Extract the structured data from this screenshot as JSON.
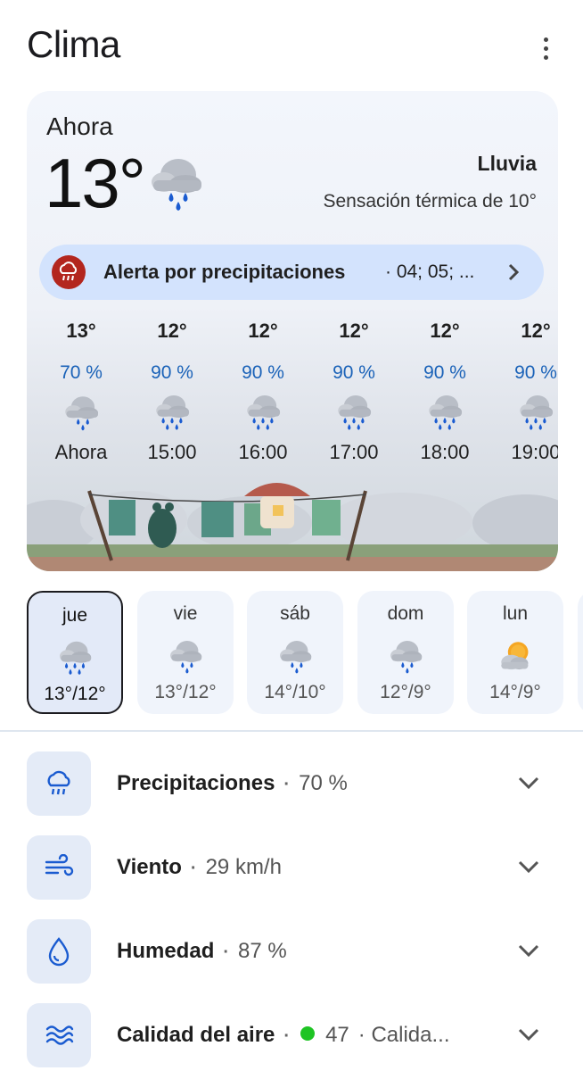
{
  "header": {
    "title": "Clima",
    "menu_icon": "more-vert-icon"
  },
  "current": {
    "label": "Ahora",
    "temperature": "13°",
    "icon": "rain-cloud-icon",
    "condition": "Lluvia",
    "feels_like": "Sensación térmica de 10°"
  },
  "alert": {
    "icon": "rain-alert-icon",
    "title": "Alerta por precipitaciones",
    "detail": "· 04; 05; ...",
    "chevron_icon": "chevron-right-icon"
  },
  "hourly": [
    {
      "temp": "13°",
      "precip": "70 %",
      "icon": "rain-cloud-icon",
      "time": "Ahora"
    },
    {
      "temp": "12°",
      "precip": "90 %",
      "icon": "heavy-rain-icon",
      "time": "15:00"
    },
    {
      "temp": "12°",
      "precip": "90 %",
      "icon": "heavy-rain-icon",
      "time": "16:00"
    },
    {
      "temp": "12°",
      "precip": "90 %",
      "icon": "heavy-rain-icon",
      "time": "17:00"
    },
    {
      "temp": "12°",
      "precip": "90 %",
      "icon": "heavy-rain-icon",
      "time": "18:00"
    },
    {
      "temp": "12°",
      "precip": "90 %",
      "icon": "heavy-rain-icon",
      "time": "19:00"
    }
  ],
  "daily": [
    {
      "day": "jue",
      "icon": "heavy-rain-icon",
      "range": "13°/12°",
      "selected": true
    },
    {
      "day": "vie",
      "icon": "rain-cloud-icon",
      "range": "13°/12°"
    },
    {
      "day": "sáb",
      "icon": "rain-cloud-icon",
      "range": "14°/10°"
    },
    {
      "day": "dom",
      "icon": "rain-cloud-icon",
      "range": "12°/9°"
    },
    {
      "day": "lun",
      "icon": "partly-sunny-icon",
      "range": "14°/9°"
    }
  ],
  "details": [
    {
      "name": "Precipitaciones",
      "value": "70 %",
      "icon": "umbrella-rain-icon"
    },
    {
      "name": "Viento",
      "value": "29 km/h",
      "icon": "wind-icon"
    },
    {
      "name": "Humedad",
      "value": "87 %",
      "icon": "water-drop-icon"
    },
    {
      "name": "Calidad del aire",
      "value": "47",
      "extra": "· Calida...",
      "icon": "air-quality-icon",
      "indicator_color": "#1ec424"
    }
  ],
  "colors": {
    "accent": "#1a62b8",
    "alert": "#b3261e",
    "alert_bg": "#d3e3fd"
  }
}
